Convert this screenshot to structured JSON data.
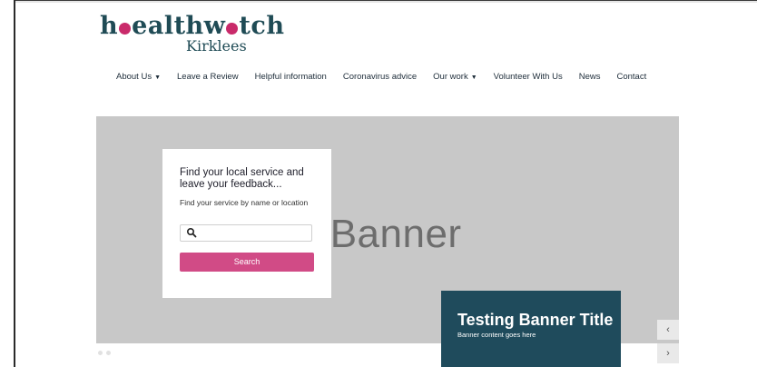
{
  "logo": {
    "brand_prefix": "h",
    "brand_part1": "ealthw",
    "brand_part2": "tch",
    "sub": "Kirklees"
  },
  "nav": {
    "items": [
      {
        "label": "About Us",
        "caret": "▼"
      },
      {
        "label": "Leave a Review"
      },
      {
        "label": "Helpful information"
      },
      {
        "label": "Coronavirus advice"
      },
      {
        "label": "Our work",
        "caret": "▼"
      },
      {
        "label": "Volunteer With Us"
      },
      {
        "label": "News"
      },
      {
        "label": "Contact"
      }
    ]
  },
  "banner": {
    "placeholder_text": "e Banner",
    "search_card": {
      "title": "Find your local service and leave your feedback...",
      "subtitle": "Find your service by name or location",
      "input_value": "",
      "search_button": "Search"
    },
    "caption": {
      "title": "Testing Banner Title",
      "text": "Banner content goes here"
    },
    "controls": {
      "prev": "‹",
      "next": "›"
    }
  },
  "colors": {
    "brand_dark": "#1f4b55",
    "brand_pink": "#d14b86",
    "banner_gray": "#c8c8c8",
    "caption_bg": "#1f4b5c"
  }
}
